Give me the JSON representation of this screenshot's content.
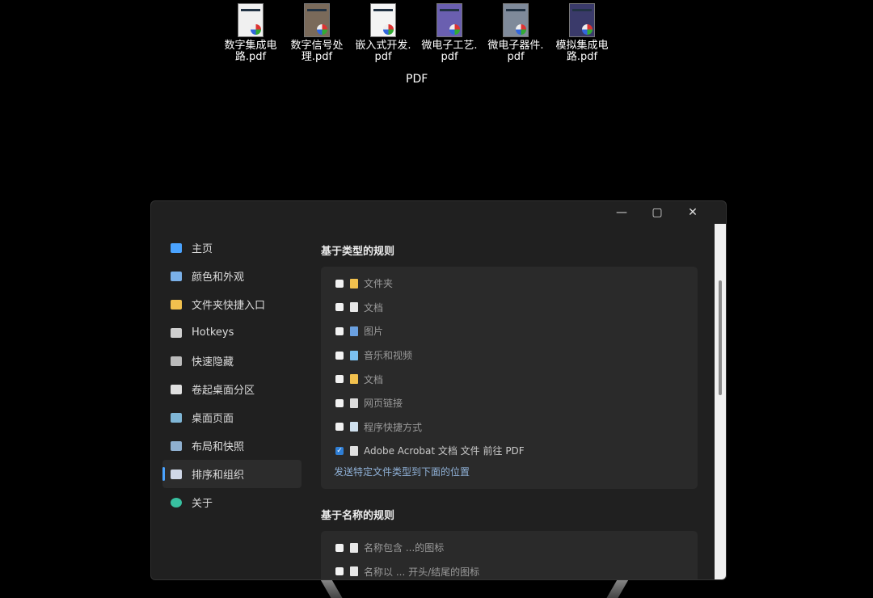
{
  "desktop": {
    "icons": [
      {
        "name": "数字集成电路.pdf",
        "line1": "数字集成电",
        "line2": "路.pdf",
        "color": "#f0f0f0"
      },
      {
        "name": "数字信号处理.pdf",
        "line1": "数字信号处",
        "line2": "理.pdf",
        "color": "#7a6a5a"
      },
      {
        "name": "嵌入式开发.pdf",
        "line1": "嵌入式开发.",
        "line2": "pdf",
        "color": "#f4f4f4"
      },
      {
        "name": "微电子工艺.pdf",
        "line1": "微电子工艺.",
        "line2": "pdf",
        "color": "#6a5fb0"
      },
      {
        "name": "微电子器件.pdf",
        "line1": "微电子器件.",
        "line2": "pdf",
        "color": "#7f8a9a"
      },
      {
        "name": "模拟集成电路.pdf",
        "line1": "模拟集成电",
        "line2": "路.pdf",
        "color": "#3a3a6a"
      }
    ],
    "fence_label": "PDF"
  },
  "window": {
    "minimize": "—",
    "maximize": "▢",
    "close": "✕"
  },
  "sidebar": {
    "items": [
      {
        "label": "主页",
        "icon": "monitor-icon",
        "color": "#4aa3ff"
      },
      {
        "label": "颜色和外观",
        "icon": "palette-icon",
        "color": "#7ab0e8"
      },
      {
        "label": "文件夹快捷入口",
        "icon": "folder-icon",
        "color": "#f2c14e"
      },
      {
        "label": "Hotkeys",
        "icon": "keyboard-icon",
        "color": "#cfcfcf"
      },
      {
        "label": "快速隐藏",
        "icon": "hide-icon",
        "color": "#bbbbbb"
      },
      {
        "label": "卷起桌面分区",
        "icon": "chevron-down-icon",
        "color": "#e0e0e0"
      },
      {
        "label": "桌面页面",
        "icon": "pages-icon",
        "color": "#7fb6d6"
      },
      {
        "label": "布局和快照",
        "icon": "layout-icon",
        "color": "#8fb0d0"
      },
      {
        "label": "排序和组织",
        "icon": "filter-icon",
        "color": "#d0d8e8"
      },
      {
        "label": "关于",
        "icon": "person-icon",
        "color": "#38c0a0"
      }
    ],
    "active_index": 8
  },
  "content": {
    "type_rules": {
      "title": "基于类型的规则",
      "rows": [
        {
          "label": "文件夹",
          "checked": false,
          "icon": "folder-icon",
          "color": "#f2c14e"
        },
        {
          "label": "文档",
          "checked": false,
          "icon": "document-icon",
          "color": "#e8e8e8"
        },
        {
          "label": "图片",
          "checked": false,
          "icon": "image-icon",
          "color": "#6aa0e0"
        },
        {
          "label": "音乐和视频",
          "checked": false,
          "icon": "music-icon",
          "color": "#7ac0f0"
        },
        {
          "label": "文档",
          "checked": false,
          "icon": "archive-icon",
          "color": "#f2c14e"
        },
        {
          "label": "网页链接",
          "checked": false,
          "icon": "web-link-icon",
          "color": "#dcdcdc"
        },
        {
          "label": "程序快捷方式",
          "checked": false,
          "icon": "program-icon",
          "color": "#cfe0ee"
        },
        {
          "label": "Adobe Acrobat 文档 文件 前往 PDF",
          "checked": true,
          "icon": "pdf-icon",
          "color": "#e0e0e0"
        }
      ],
      "link": "发送特定文件类型到下面的位置"
    },
    "name_rules": {
      "title": "基于名称的规则",
      "rows": [
        {
          "label": "名称包含 ...的图标",
          "checked": false,
          "icon": "document-icon",
          "color": "#e8e8e8"
        },
        {
          "label": "名称以 ... 开头/结尾的图标",
          "checked": false,
          "icon": "document-icon",
          "color": "#e8e8e8"
        }
      ]
    }
  }
}
